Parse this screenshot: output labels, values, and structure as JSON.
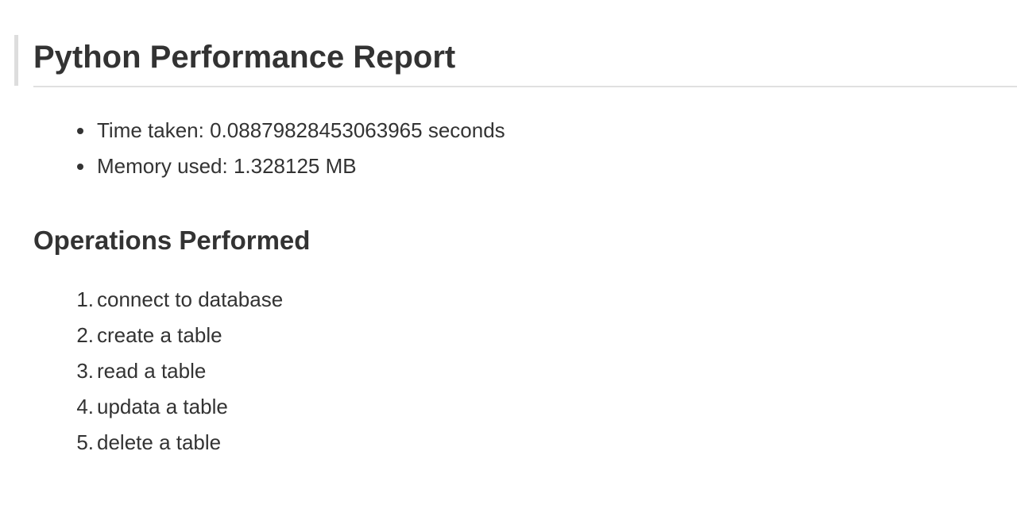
{
  "report": {
    "title": "Python Performance Report",
    "metrics": [
      {
        "text": "Time taken: 0.08879828453063965 seconds"
      },
      {
        "text": "Memory used: 1.328125 MB"
      }
    ],
    "operations_heading": "Operations Performed",
    "operations": [
      {
        "marker": "1.",
        "text": "connect to database"
      },
      {
        "marker": "2.",
        "text": "create a table"
      },
      {
        "marker": "3.",
        "text": "read a table"
      },
      {
        "marker": "4.",
        "text": "updata a table"
      },
      {
        "marker": "5.",
        "text": "delete a table"
      }
    ]
  },
  "colors": {
    "text": "#333333",
    "title_bar": "#dddddd",
    "rule": "#e0e0e0",
    "background": "#ffffff"
  }
}
